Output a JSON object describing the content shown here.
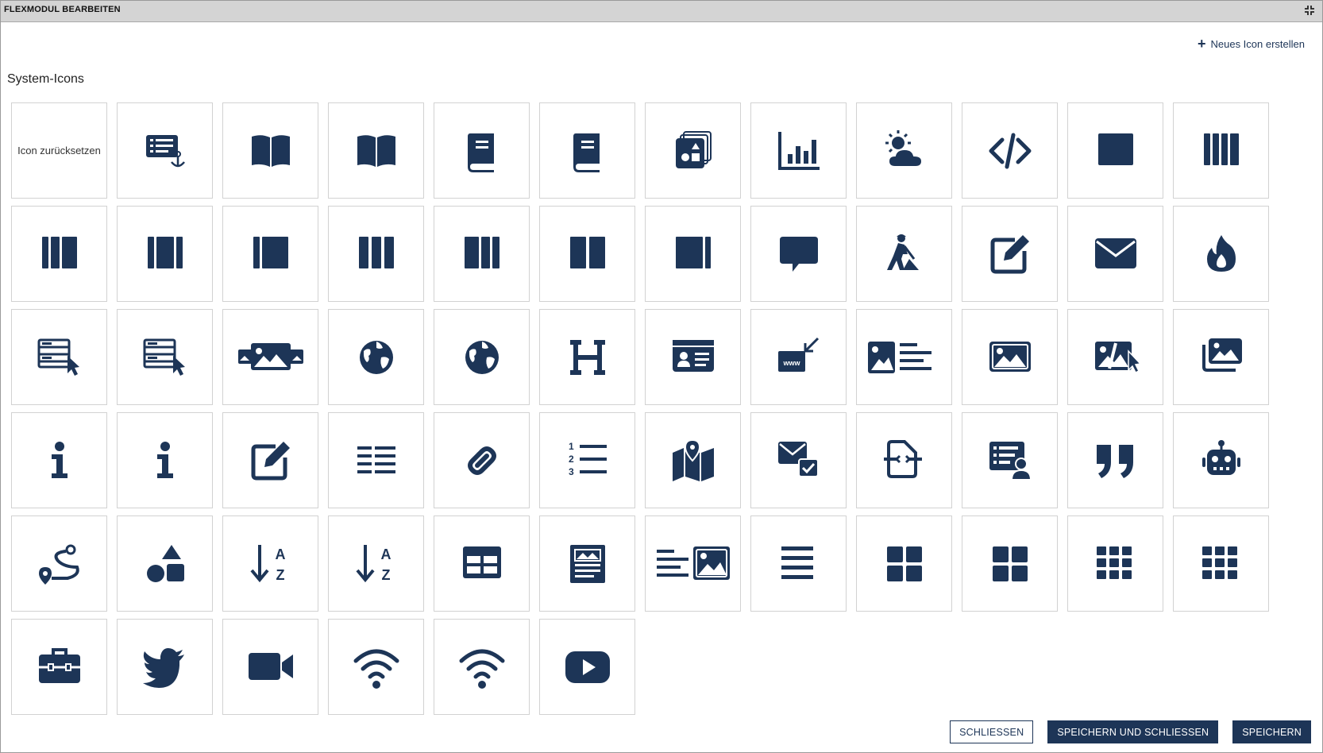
{
  "dialog": {
    "title": "FLEXMODUL BEARBEITEN",
    "new_icon_label": "Neues Icon erstellen",
    "section_title": "System-Icons",
    "reset_label": "Icon zurücksetzen"
  },
  "colors": {
    "icon": "#1d3557",
    "titlebar": "#d4d4d4",
    "tile_border": "#d2d2d2"
  },
  "icons": [
    "reset",
    "list-anchor",
    "book-open",
    "book-open",
    "book",
    "book",
    "layers-shapes",
    "chart-bar",
    "weather-sun-cloud",
    "code",
    "square",
    "columns-4",
    "columns-3",
    "columns-3-alt",
    "sidebar-left",
    "columns-3-equal",
    "columns-2-1",
    "columns-2",
    "sidebar-right",
    "comment",
    "construction-worker",
    "edit-square",
    "envelope",
    "fire",
    "form-cursor",
    "form-cursor",
    "image-carousel",
    "globe",
    "globe",
    "heading",
    "id-card",
    "www-import",
    "image-text",
    "image",
    "image-edit-cursor",
    "images",
    "info",
    "info",
    "edit-square",
    "list",
    "link",
    "list-ordered",
    "map-marker",
    "envelope-check",
    "arrows-h-code",
    "list-user",
    "quote",
    "robot",
    "route",
    "shapes",
    "sort-alpha-down",
    "sort-alpha-down",
    "table",
    "newspaper",
    "text-image",
    "align-justify",
    "grid-2x2",
    "grid-2x2",
    "grid-3x3",
    "grid-3x3",
    "toolbox",
    "twitter",
    "video",
    "wifi",
    "wifi",
    "youtube"
  ],
  "footer": {
    "close_label": "SCHLIESSEN",
    "save_close_label": "SPEICHERN UND SCHLIESSEN",
    "save_label": "SPEICHERN"
  }
}
